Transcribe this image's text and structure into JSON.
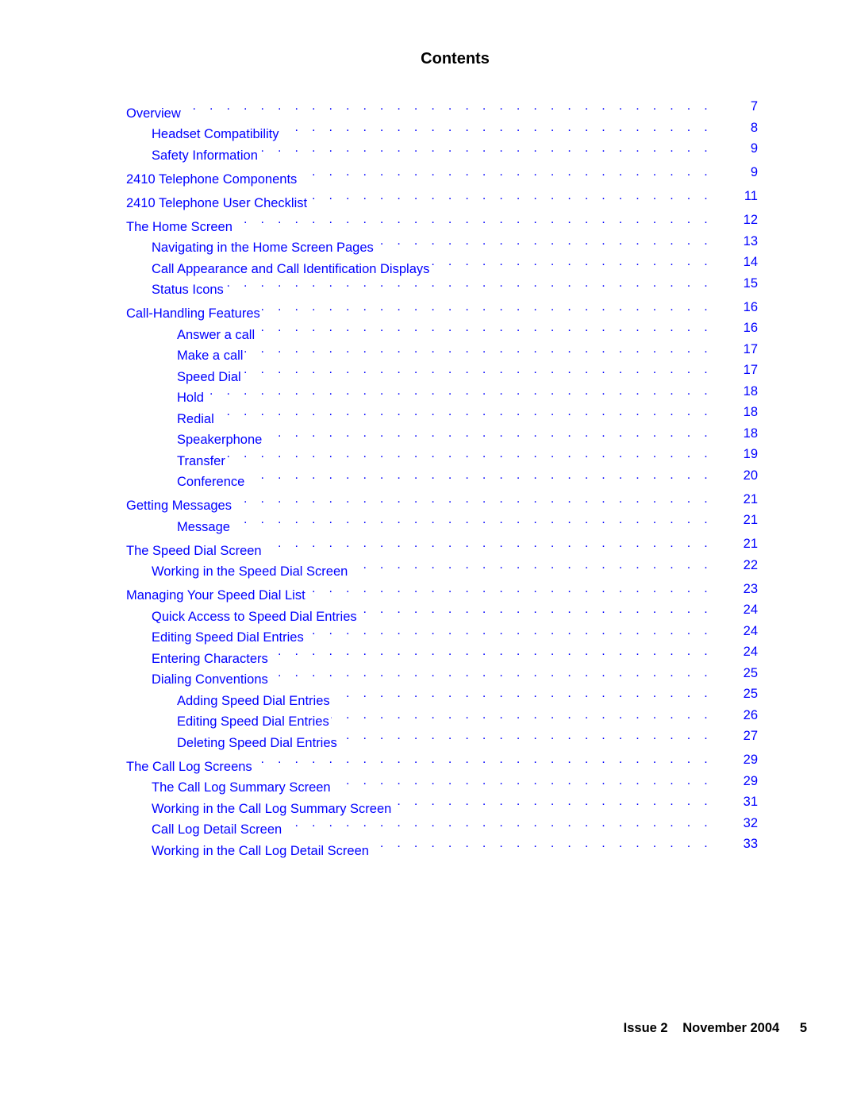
{
  "page": {
    "title": "Contents"
  },
  "toc": [
    {
      "level": 1,
      "title": "Overview",
      "page": "7"
    },
    {
      "level": 2,
      "title": "Headset Compatibility",
      "page": "8"
    },
    {
      "level": 2,
      "title": "Safety Information",
      "page": "9"
    },
    {
      "level": 1,
      "title": "2410 Telephone Components",
      "page": "9"
    },
    {
      "level": 1,
      "title": "2410 Telephone User Checklist",
      "page": "11"
    },
    {
      "level": 1,
      "title": "The Home Screen",
      "page": "12"
    },
    {
      "level": 2,
      "title": "Navigating in the Home Screen Pages",
      "page": "13"
    },
    {
      "level": 2,
      "title": "Call Appearance and Call Identification Displays",
      "page": "14"
    },
    {
      "level": 2,
      "title": "Status Icons",
      "page": "15"
    },
    {
      "level": 1,
      "title": "Call-Handling Features",
      "page": "16"
    },
    {
      "level": 3,
      "title": "Answer a call",
      "page": "16"
    },
    {
      "level": 3,
      "title": "Make a call",
      "page": "17"
    },
    {
      "level": 3,
      "title": "Speed Dial",
      "page": "17"
    },
    {
      "level": 3,
      "title": "Hold",
      "page": "18"
    },
    {
      "level": 3,
      "title": "Redial",
      "page": "18"
    },
    {
      "level": 3,
      "title": "Speakerphone",
      "page": "18"
    },
    {
      "level": 3,
      "title": "Transfer",
      "page": "19"
    },
    {
      "level": 3,
      "title": "Conference",
      "page": "20"
    },
    {
      "level": 1,
      "title": "Getting Messages",
      "page": "21"
    },
    {
      "level": 3,
      "title": "Message",
      "page": "21"
    },
    {
      "level": 1,
      "title": "The Speed Dial Screen",
      "page": "21"
    },
    {
      "level": 2,
      "title": "Working in the Speed Dial Screen",
      "page": "22"
    },
    {
      "level": 1,
      "title": "Managing Your Speed Dial List",
      "page": "23"
    },
    {
      "level": 2,
      "title": "Quick Access to Speed Dial Entries",
      "page": "24"
    },
    {
      "level": 2,
      "title": "Editing Speed Dial Entries",
      "page": "24"
    },
    {
      "level": 2,
      "title": "Entering Characters",
      "page": "24"
    },
    {
      "level": 2,
      "title": "Dialing Conventions",
      "page": "25"
    },
    {
      "level": 3,
      "title": "Adding Speed Dial Entries",
      "page": "25"
    },
    {
      "level": 3,
      "title": "Editing Speed Dial Entries",
      "page": "26"
    },
    {
      "level": 3,
      "title": "Deleting Speed Dial Entries",
      "page": "27"
    },
    {
      "level": 1,
      "title": "The Call Log Screens",
      "page": "29"
    },
    {
      "level": 2,
      "title": "The Call Log Summary Screen",
      "page": "29"
    },
    {
      "level": 2,
      "title": "Working in the Call Log Summary Screen",
      "page": "31"
    },
    {
      "level": 2,
      "title": "Call Log Detail Screen",
      "page": "32"
    },
    {
      "level": 2,
      "title": "Working in the Call Log Detail Screen",
      "page": "33"
    }
  ],
  "footer": {
    "issue": "Issue 2",
    "date": "November 2004",
    "page_number": "5"
  },
  "colors": {
    "link": "#0000ff",
    "text": "#000000"
  }
}
